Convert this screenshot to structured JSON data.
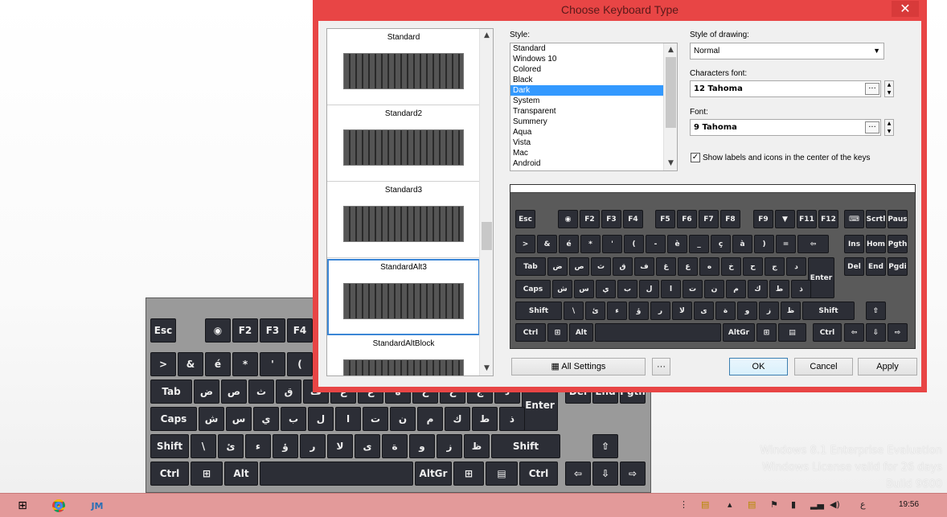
{
  "dialog": {
    "title": "Choose Keyboard Type",
    "close_label": "✕",
    "thumbnails": [
      "Standard",
      "Standard2",
      "Standard3",
      "StandardAlt3",
      "StandardAltBlock"
    ],
    "selected_thumbnail": "StandardAlt3",
    "style_label": "Style:",
    "styles": [
      "Standard",
      "Windows 10",
      "Colored",
      "Black",
      "Dark",
      "System",
      "Transparent",
      "Summery",
      "Aqua",
      "Vista",
      "Mac",
      "Android"
    ],
    "selected_style": "Dark",
    "style_of_drawing_label": "Style of drawing:",
    "style_of_drawing_value": "Normal",
    "characters_font_label": "Characters font:",
    "characters_font_value": "12 Tahoma",
    "font_label": "Font:",
    "font_value": "9 Tahoma",
    "show_labels_text": "Show labels and icons in the center of the keys",
    "show_labels_checked": true,
    "buttons": {
      "all_settings": "All Settings",
      "more": "···",
      "ok": "OK",
      "cancel": "Cancel",
      "apply": "Apply"
    }
  },
  "preview_keyboard": {
    "row_f": [
      "Esc",
      "◉",
      "F2",
      "F3",
      "F4",
      "F5",
      "F6",
      "F7",
      "F8",
      "F9",
      "▼",
      "F11",
      "F12",
      "⌨",
      "Scrtl",
      "Paus"
    ],
    "row_num": [
      ">",
      "&",
      "é",
      "*",
      "'",
      "(",
      "-",
      "è",
      "_",
      "ç",
      "à",
      ")",
      "=",
      "⇦",
      "Ins",
      "Hom",
      "Pgth"
    ],
    "row_tab": [
      "Tab",
      "ض",
      "ص",
      "ث",
      "ق",
      "ف",
      "غ",
      "ع",
      "ه",
      "خ",
      "ح",
      "ج",
      "د",
      "Enter",
      "Del",
      "End",
      "Pgdi"
    ],
    "row_caps": [
      "Caps",
      "ش",
      "س",
      "ي",
      "ب",
      "ل",
      "ا",
      "ت",
      "ن",
      "م",
      "ك",
      "ط",
      "ذ"
    ],
    "row_shift": [
      "Shift",
      "\\",
      "ئ",
      "ء",
      "ؤ",
      "ر",
      "لا",
      "ى",
      "ة",
      "و",
      "ز",
      "ظ",
      "Shift",
      "⇧"
    ],
    "row_ctrl": [
      "Ctrl",
      "⊞",
      "Alt",
      "AltGr",
      "⊞",
      "▤",
      "Ctrl",
      "⇦",
      "⇩",
      "⇨"
    ]
  },
  "bg_keyboard": {
    "row_f": [
      "Esc",
      "◉",
      "F2",
      "F3",
      "F4"
    ],
    "row_num": [
      ">",
      "&",
      "é",
      "*",
      "'",
      "("
    ],
    "row_tab": [
      "Tab",
      "ض",
      "ص",
      "ث",
      "ق",
      "ف",
      "غ",
      "ع",
      "ه",
      "خ",
      "ح",
      "ج",
      "د",
      "Enter",
      "Del",
      "End",
      "Pgth"
    ],
    "row_caps": [
      "Caps",
      "ش",
      "س",
      "ي",
      "ب",
      "ل",
      "ا",
      "ت",
      "ن",
      "م",
      "ك",
      "ط",
      "ذ"
    ],
    "row_shift": [
      "Shift",
      "\\",
      "ئ",
      "ء",
      "ؤ",
      "ر",
      "لا",
      "ى",
      "ة",
      "و",
      "ز",
      "ظ",
      "Shift",
      "⇧"
    ],
    "row_ctrl": [
      "Ctrl",
      "⊞",
      "Alt",
      "AltGr",
      "⊞",
      "▤",
      "Ctrl",
      "⇦",
      "⇩",
      "⇨"
    ]
  },
  "watermark": [
    "Windows 8.1 Enterprise Evaluation",
    "Windows License valid for 26 days",
    "Build 9600"
  ],
  "taskbar": {
    "clock": "19:56",
    "lang": "ع",
    "apps": [
      "windows-start",
      "chrome",
      "network-app",
      "keyboard-app"
    ]
  },
  "colors": {
    "dialog_border": "#e84545",
    "selection": "#3399ff",
    "key_bg": "#2c2e36",
    "taskbar": "#e39a9a"
  }
}
